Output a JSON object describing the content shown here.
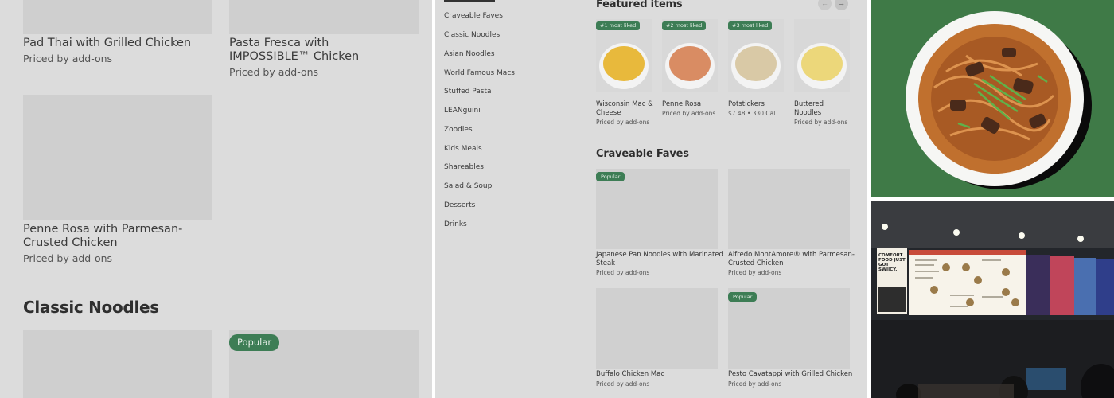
{
  "left_panel": {
    "items_top": [
      {
        "name": "Pad Thai with Grilled Chicken",
        "price": "Priced by add-ons"
      },
      {
        "name": "Pasta Fresca with IMPOSSIBLE™ Chicken",
        "price": "Priced by add-ons"
      }
    ],
    "item_mid": {
      "name": "Penne Rosa with Parmesan-Crusted Chicken",
      "price": "Priced by add-ons"
    },
    "section_heading": "Classic Noodles",
    "popular_badge": "Popular"
  },
  "middle_panel": {
    "nav": [
      "Craveable Faves",
      "Classic Noodles",
      "Asian Noodles",
      "World Famous Macs",
      "Stuffed Pasta",
      "LEANguini",
      "Zoodles",
      "Kids Meals",
      "Shareables",
      "Salad & Soup",
      "Desserts",
      "Drinks"
    ],
    "featured_heading": "Featured items",
    "prev_arrow": "←",
    "next_arrow": "→",
    "featured": [
      {
        "badge": "#1 most liked",
        "name": "Wisconsin Mac & Cheese",
        "price": "Priced by add-ons",
        "color": "#e8b93c"
      },
      {
        "badge": "#2 most liked",
        "name": "Penne Rosa",
        "price": "Priced by add-ons",
        "color": "#d98c63"
      },
      {
        "badge": "#3 most liked",
        "name": "Potstickers",
        "price": "$7.48 • 330 Cal.",
        "color": "#d9c9a6"
      },
      {
        "badge": "",
        "name": "Buttered Noodles",
        "price": "Priced by add-ons",
        "color": "#ecd77a"
      }
    ],
    "craveable_heading": "Craveable Faves",
    "cards": [
      {
        "badge": "Popular",
        "name": "Japanese Pan Noodles with Marinated Steak",
        "price": "Priced by add-ons"
      },
      {
        "badge": "",
        "name": "Alfredo MontAmore® with Parmesan-Crusted Chicken",
        "price": "Priced by add-ons"
      },
      {
        "badge": "",
        "name": "Buffalo Chicken Mac",
        "price": "Priced by add-ons"
      },
      {
        "badge": "Popular",
        "name": "Pesto Cavatappi with Grilled Chicken",
        "price": "Priced by add-ons"
      }
    ]
  },
  "store_photo": {
    "poster_text": "COMFORT FOOD JUST GOT SWIICY."
  },
  "colors": {
    "badge_green": "#3d7d55",
    "dish_background": "#3f7a47",
    "overlay_gray": "#dcdcdc"
  }
}
